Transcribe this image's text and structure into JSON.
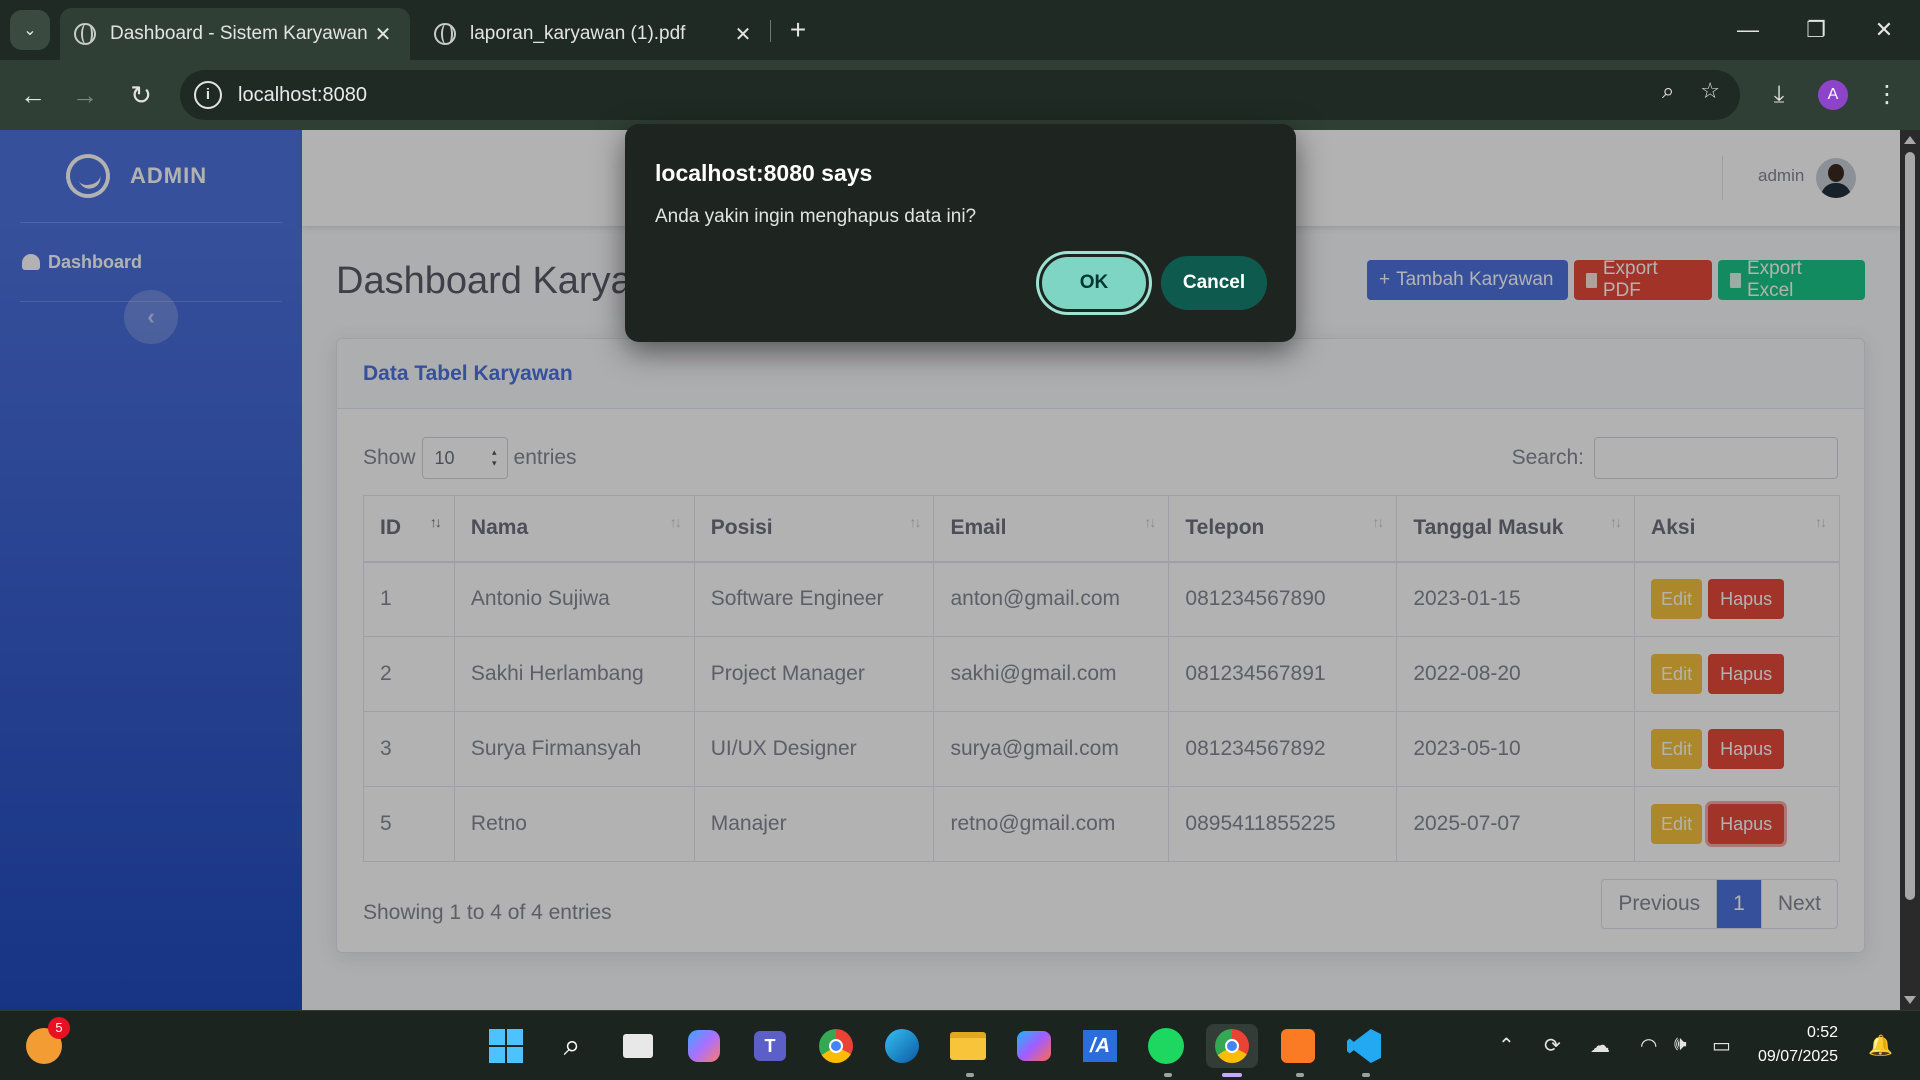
{
  "browser": {
    "tabs": [
      {
        "title": "Dashboard - Sistem Karyawan",
        "active": true
      },
      {
        "title": "laporan_karyawan (1).pdf",
        "active": false
      }
    ],
    "url": "localhost:8080",
    "profile_initial": "A"
  },
  "sidebar": {
    "brand": "ADMIN",
    "items": [
      {
        "label": "Dashboard"
      }
    ],
    "toggle_glyph": "‹"
  },
  "topbar": {
    "user": "admin"
  },
  "page": {
    "title": "Dashboard Karyawan",
    "buttons": {
      "add": "Tambah Karyawan",
      "export_pdf": "Export PDF",
      "export_excel": "Export Excel"
    }
  },
  "card": {
    "title": "Data Tabel Karyawan",
    "show_label": "Show",
    "entries_label": "entries",
    "page_length": "10",
    "search_label": "Search:",
    "search_value": ""
  },
  "table": {
    "headers": [
      "ID",
      "Nama",
      "Posisi",
      "Email",
      "Telepon",
      "Tanggal Masuk",
      "Aksi"
    ],
    "rows": [
      {
        "id": "1",
        "nama": "Antonio Sujiwa",
        "posisi": "Software Engineer",
        "email": "anton@gmail.com",
        "telepon": "081234567890",
        "tanggal": "2023-01-15"
      },
      {
        "id": "2",
        "nama": "Sakhi Herlambang",
        "posisi": "Project Manager",
        "email": "sakhi@gmail.com",
        "telepon": "081234567891",
        "tanggal": "2022-08-20"
      },
      {
        "id": "3",
        "nama": "Surya Firmansyah",
        "posisi": "UI/UX Designer",
        "email": "surya@gmail.com",
        "telepon": "081234567892",
        "tanggal": "2023-05-10"
      },
      {
        "id": "5",
        "nama": "Retno",
        "posisi": "Manajer",
        "email": "retno@gmail.com",
        "telepon": "0895411855225",
        "tanggal": "2025-07-07"
      }
    ],
    "edit_label": "Edit",
    "delete_label": "Hapus"
  },
  "footer": {
    "info": "Showing 1 to 4 of 4 entries",
    "prev": "Previous",
    "current_page": "1",
    "next": "Next"
  },
  "dialog": {
    "title": "localhost:8080 says",
    "message": "Anda yakin ingin menghapus data ini?",
    "ok": "OK",
    "cancel": "Cancel"
  },
  "taskbar": {
    "notification_count": "5",
    "time": "0:52",
    "date": "09/07/2025"
  },
  "colors": {
    "primary": "#4e73df",
    "danger": "#e74a3b",
    "success": "#1cc88a",
    "warning": "#f6c23e",
    "dialog_ok": "#7fd5c4",
    "dialog_cancel": "#0f5a4e"
  }
}
